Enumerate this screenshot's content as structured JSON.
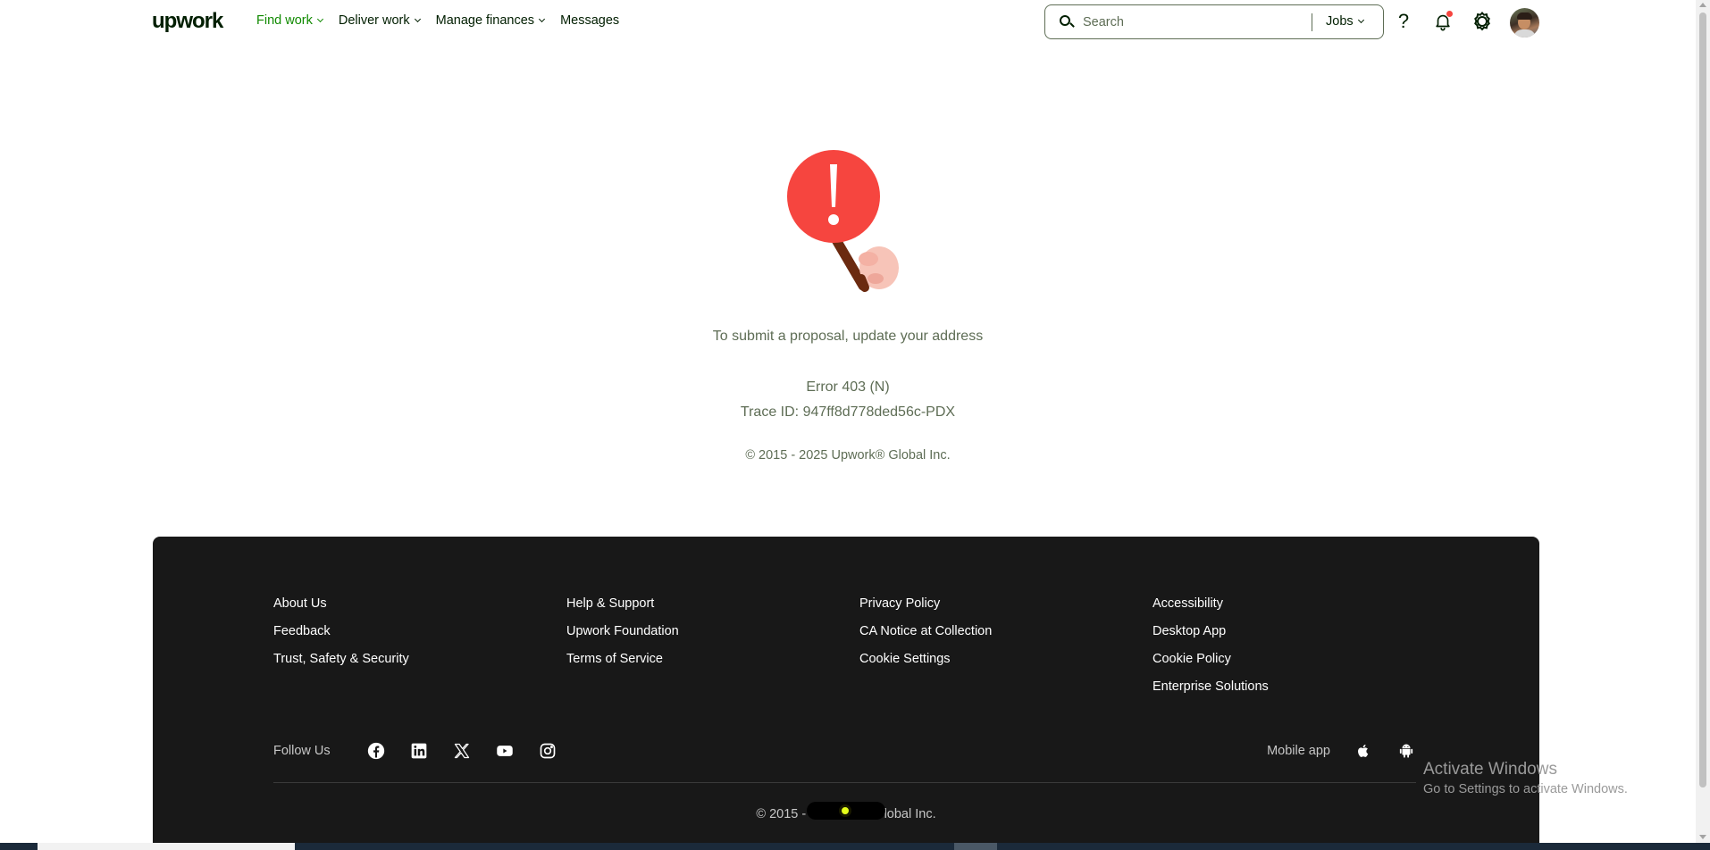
{
  "header": {
    "logo": "upwork",
    "nav": [
      {
        "label": "Find work",
        "active": true
      },
      {
        "label": "Deliver work",
        "active": false
      },
      {
        "label": "Manage finances",
        "active": false
      },
      {
        "label": "Messages",
        "active": false
      }
    ],
    "search": {
      "placeholder": "Search",
      "scope": "Jobs"
    },
    "help_glyph": "?"
  },
  "error": {
    "message": "To submit a proposal, update your address",
    "code": "Error 403 (N)",
    "trace": "Trace ID: 947ff8d778ded56c-PDX",
    "copyright": "© 2015 - 2025 Upwork® Global Inc."
  },
  "footer": {
    "columns": [
      [
        "About Us",
        "Feedback",
        "Trust, Safety & Security"
      ],
      [
        "Help & Support",
        "Upwork Foundation",
        "Terms of Service"
      ],
      [
        "Privacy Policy",
        "CA Notice at Collection",
        "Cookie Settings"
      ],
      [
        "Accessibility",
        "Desktop App",
        "Cookie Policy",
        "Enterprise Solutions"
      ]
    ],
    "follow_label": "Follow Us",
    "social_icons": [
      "facebook-icon",
      "linkedin-icon",
      "x-icon",
      "youtube-icon",
      "instagram-icon"
    ],
    "mobile_label": "Mobile app",
    "mobile_icons": [
      "apple-icon",
      "android-icon"
    ],
    "copyright_left": "© 2015 - 2",
    "copyright_right": "Global Inc."
  },
  "watermark": {
    "title": "Activate Windows",
    "subtitle": "Go to Settings to activate Windows."
  },
  "colors": {
    "brand_green": "#108a00",
    "footer_bg": "#181818",
    "error_red": "#f6453f",
    "text_muted": "#5e6d55"
  }
}
